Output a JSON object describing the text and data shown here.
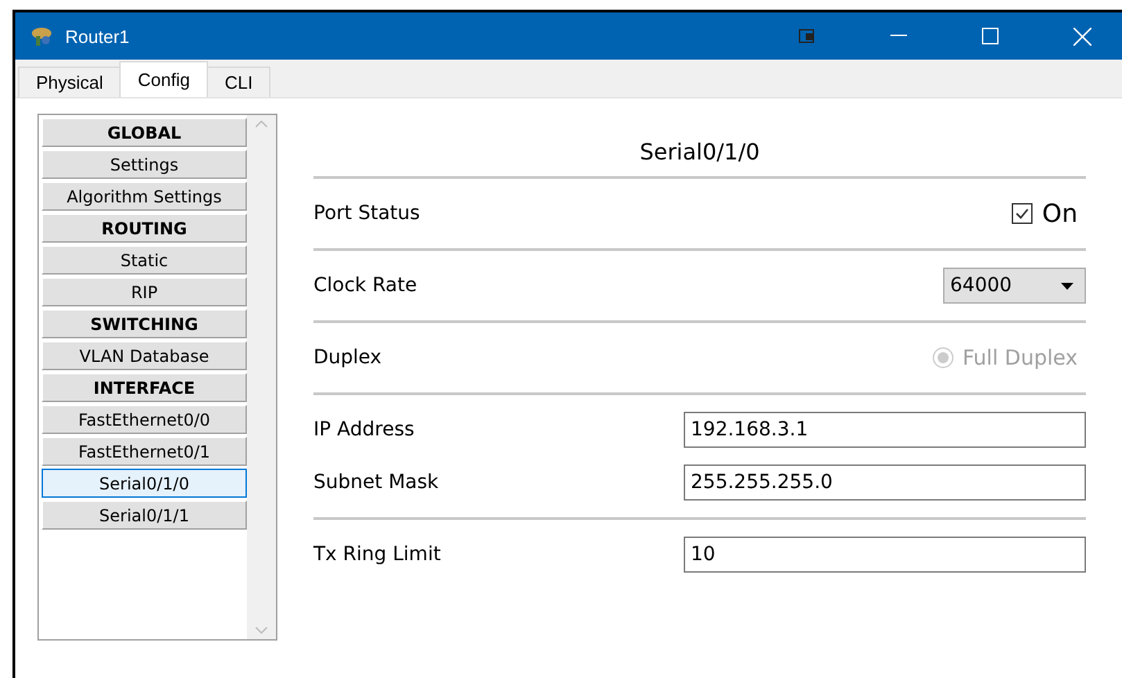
{
  "window": {
    "title": "Router1"
  },
  "tabs": [
    {
      "label": "Physical",
      "selected": false
    },
    {
      "label": "Config",
      "selected": true
    },
    {
      "label": "CLI",
      "selected": false
    }
  ],
  "sidebar": {
    "items": [
      {
        "label": "GLOBAL",
        "kind": "header",
        "selected": false
      },
      {
        "label": "Settings",
        "kind": "item",
        "selected": false
      },
      {
        "label": "Algorithm Settings",
        "kind": "item",
        "selected": false
      },
      {
        "label": "ROUTING",
        "kind": "header",
        "selected": false
      },
      {
        "label": "Static",
        "kind": "item",
        "selected": false
      },
      {
        "label": "RIP",
        "kind": "item",
        "selected": false
      },
      {
        "label": "SWITCHING",
        "kind": "header",
        "selected": false
      },
      {
        "label": "VLAN Database",
        "kind": "item",
        "selected": false
      },
      {
        "label": "INTERFACE",
        "kind": "header",
        "selected": false
      },
      {
        "label": "FastEthernet0/0",
        "kind": "item",
        "selected": false
      },
      {
        "label": "FastEthernet0/1",
        "kind": "item",
        "selected": false
      },
      {
        "label": "Serial0/1/0",
        "kind": "item",
        "selected": true
      },
      {
        "label": "Serial0/1/1",
        "kind": "item",
        "selected": false
      }
    ]
  },
  "panel": {
    "title": "Serial0/1/0",
    "sections": [
      {
        "fields": [
          {
            "kind": "checkbox",
            "label": "Port Status",
            "option": "On",
            "checked": true
          }
        ]
      },
      {
        "fields": [
          {
            "kind": "select",
            "label": "Clock Rate",
            "value": "64000"
          }
        ]
      },
      {
        "fields": [
          {
            "kind": "radio",
            "label": "Duplex",
            "option": "Full Duplex",
            "checked": true,
            "disabled": true
          }
        ]
      },
      {
        "fields": [
          {
            "kind": "text",
            "label": "IP Address",
            "value": "192.168.3.1"
          },
          {
            "kind": "text",
            "label": "Subnet Mask",
            "value": "255.255.255.0"
          }
        ]
      },
      {
        "fields": [
          {
            "kind": "text",
            "label": "Tx Ring Limit",
            "value": "10"
          }
        ]
      }
    ]
  }
}
